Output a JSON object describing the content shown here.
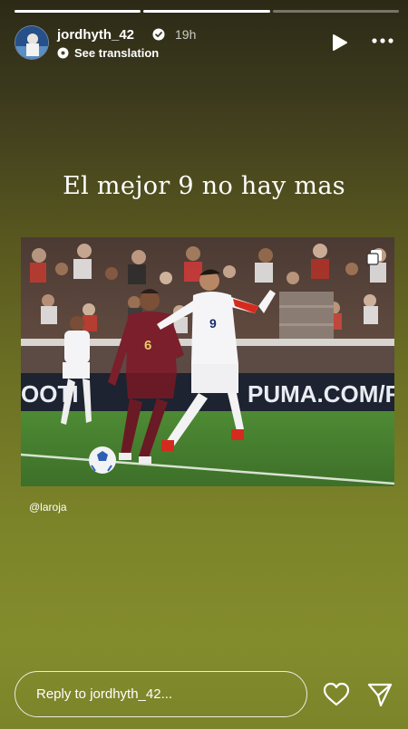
{
  "story": {
    "progress": [
      1.0,
      1.0,
      0.0
    ],
    "user": {
      "username": "jordhyth_42",
      "time": "19h",
      "verified": true
    },
    "translate_label": "See translation",
    "caption": "El mejor 9 no hay mas",
    "mention": "@laroja"
  },
  "photo": {
    "alt": "",
    "jersey_left": "6",
    "jersey_right": "9",
    "board_text": "PUMA.COM/FOOT",
    "board_text_left": "OOTI"
  },
  "reply": {
    "placeholder": "Reply to jordhyth_42..."
  },
  "icons": [
    "verified-badge-icon",
    "translate-icon",
    "play-icon",
    "more-icon",
    "multi-image-icon",
    "heart-icon",
    "send-icon"
  ],
  "colors": {
    "chile_red": "#d52b1e",
    "venezuela_maroon": "#7a1f2b",
    "pitch": "#3f7a2e"
  }
}
